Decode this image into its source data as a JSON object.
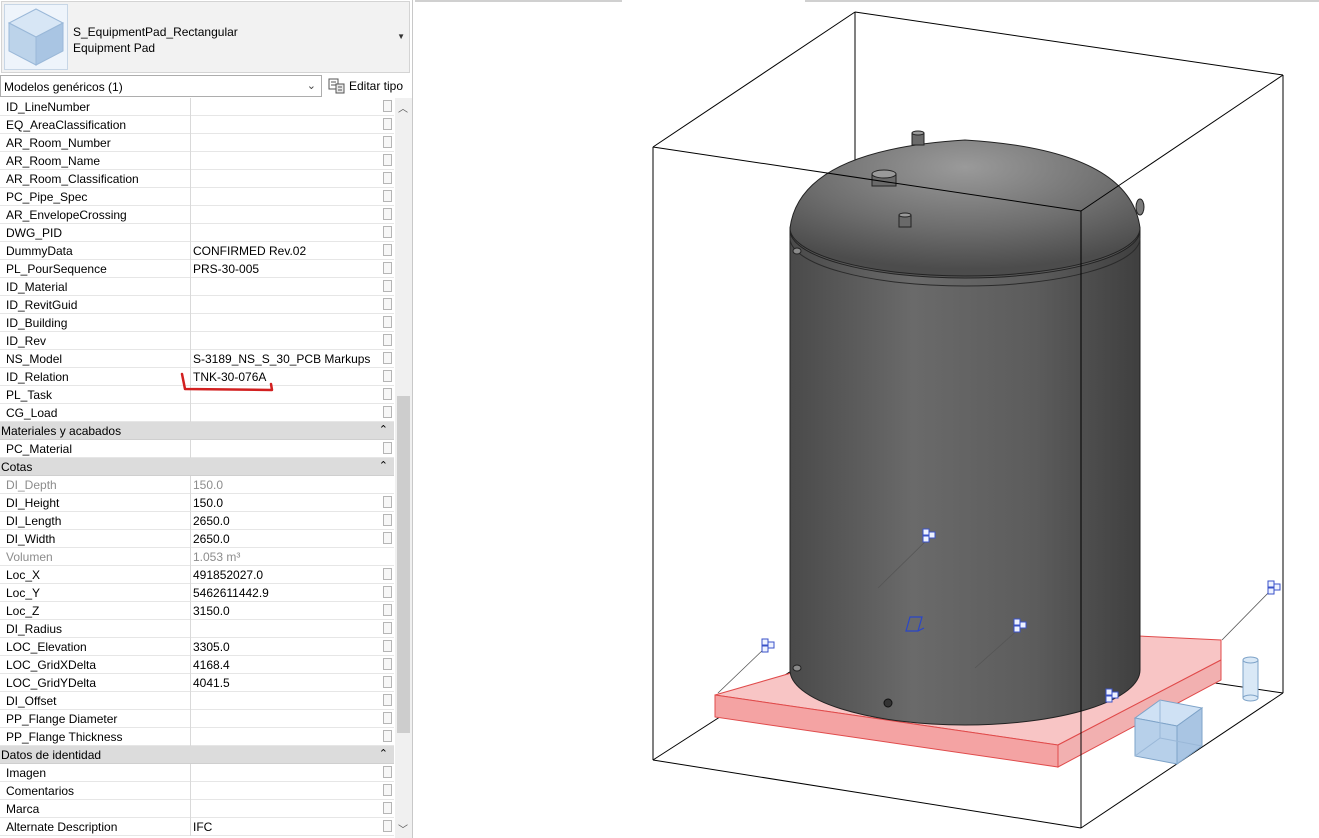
{
  "type_selector": {
    "family": "S_EquipmentPad_Rectangular",
    "type": "Equipment Pad",
    "thumbnail_icon": "cube-thumbnail-icon"
  },
  "filter": {
    "category": "Modelos genéricos (1)",
    "edit_type_label": "Editar tipo",
    "edit_type_icon": "edit-type-icon"
  },
  "groups": [
    {
      "rows": [
        {
          "name": "ID_LineNumber",
          "value": ""
        },
        {
          "name": "EQ_AreaClassification",
          "value": ""
        },
        {
          "name": "AR_Room_Number",
          "value": ""
        },
        {
          "name": "AR_Room_Name",
          "value": ""
        },
        {
          "name": "AR_Room_Classification",
          "value": ""
        },
        {
          "name": "PC_Pipe_Spec",
          "value": ""
        },
        {
          "name": "AR_EnvelopeCrossing",
          "value": ""
        },
        {
          "name": "DWG_PID",
          "value": ""
        },
        {
          "name": "DummyData",
          "value": "CONFIRMED Rev.02"
        },
        {
          "name": "PL_PourSequence",
          "value": "PRS-30-005"
        },
        {
          "name": "ID_Material",
          "value": ""
        },
        {
          "name": "ID_RevitGuid",
          "value": ""
        },
        {
          "name": "ID_Building",
          "value": ""
        },
        {
          "name": "ID_Rev",
          "value": ""
        },
        {
          "name": "NS_Model",
          "value": "S-3189_NS_S_30_PCB Markups"
        },
        {
          "name": "ID_Relation",
          "value": "TNK-30-076A"
        },
        {
          "name": "PL_Task",
          "value": ""
        },
        {
          "name": "CG_Load",
          "value": ""
        }
      ]
    },
    {
      "title": "Materiales y acabados",
      "rows": [
        {
          "name": "PC_Material",
          "value": ""
        }
      ]
    },
    {
      "title": "Cotas",
      "rows": [
        {
          "name": "DI_Depth",
          "value": "150.0",
          "readonly": true
        },
        {
          "name": "DI_Height",
          "value": "150.0"
        },
        {
          "name": "DI_Length",
          "value": "2650.0"
        },
        {
          "name": "DI_Width",
          "value": "2650.0"
        },
        {
          "name": "Volumen",
          "value": "1.053 m³",
          "readonly": true
        },
        {
          "name": "Loc_X",
          "value": "491852027.0"
        },
        {
          "name": "Loc_Y",
          "value": "5462611442.9"
        },
        {
          "name": "Loc_Z",
          "value": "3150.0"
        },
        {
          "name": "DI_Radius",
          "value": ""
        },
        {
          "name": "LOC_Elevation",
          "value": "3305.0"
        },
        {
          "name": "LOC_GridXDelta",
          "value": "4168.4"
        },
        {
          "name": "LOC_GridYDelta",
          "value": "4041.5"
        },
        {
          "name": "DI_Offset",
          "value": ""
        },
        {
          "name": "PP_Flange Diameter",
          "value": ""
        },
        {
          "name": "PP_Flange Thickness",
          "value": ""
        }
      ]
    },
    {
      "title": "Datos de identidad",
      "rows": [
        {
          "name": "Imagen",
          "value": ""
        },
        {
          "name": "Comentarios",
          "value": ""
        },
        {
          "name": "Marca",
          "value": ""
        },
        {
          "name": "Alternate Description",
          "value": "IFC"
        }
      ]
    }
  ],
  "colors": {
    "selection_pad": "#f4a3a3",
    "selection_pad_edge": "#e04b4b",
    "annotation_underline": "#d22020",
    "tank_body": "#5d5d5d",
    "group_header": "#dcdcdc"
  },
  "viewport": {
    "content": "3D view of a vertical tank on a selected rectangular equipment pad inside a section box",
    "icons": [
      "section-box-grip-icon",
      "rotation-control-icon",
      "connector-icon"
    ]
  }
}
